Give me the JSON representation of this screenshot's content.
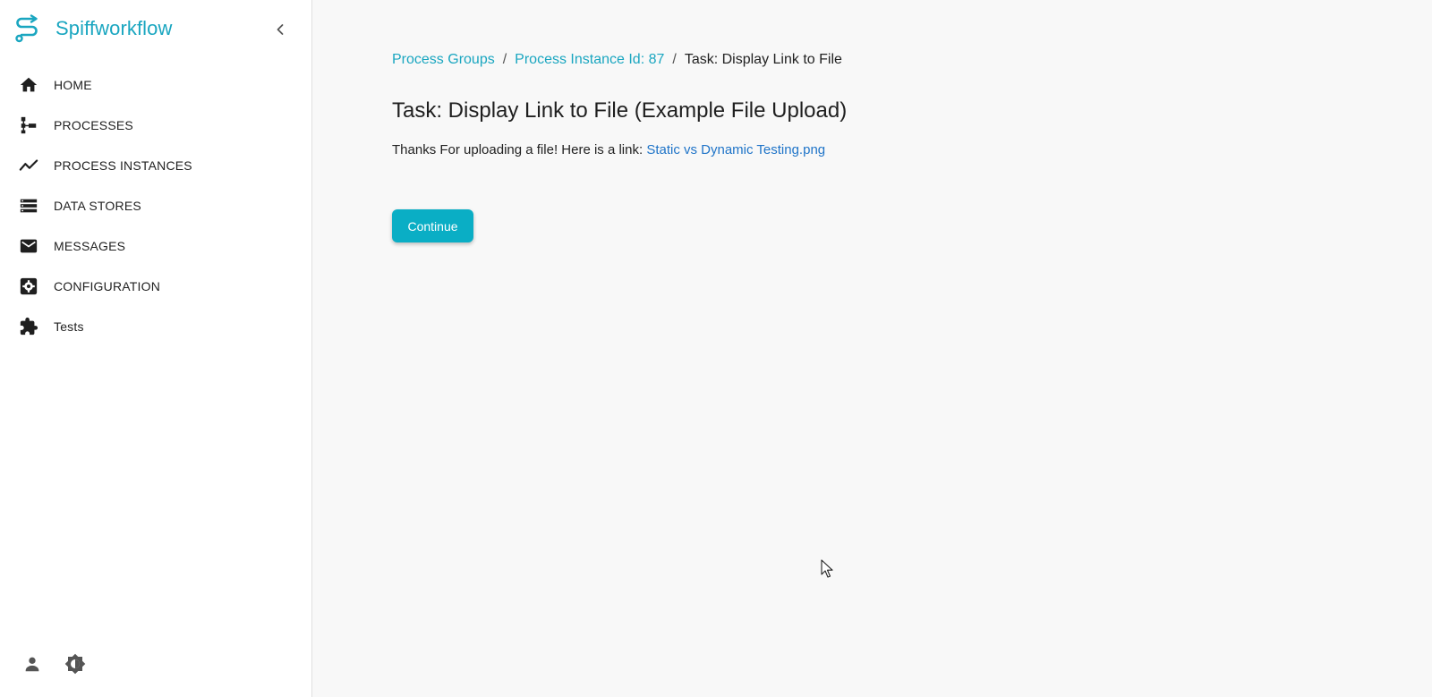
{
  "app": {
    "brand_name": "Spiffworkflow",
    "accent_color": "#1aa6c0",
    "button_color": "#0aaec5"
  },
  "sidebar": {
    "collapse_icon": "chevron-left-icon",
    "items": [
      {
        "label": "HOME",
        "icon": "home-icon"
      },
      {
        "label": "PROCESSES",
        "icon": "process-tree-icon"
      },
      {
        "label": "PROCESS INSTANCES",
        "icon": "trend-line-icon"
      },
      {
        "label": "DATA STORES",
        "icon": "storage-icon"
      },
      {
        "label": "MESSAGES",
        "icon": "mail-icon"
      },
      {
        "label": "CONFIGURATION",
        "icon": "settings-icon"
      },
      {
        "label": "Tests",
        "icon": "extension-icon"
      }
    ],
    "footer": {
      "user_icon": "user-icon",
      "theme_icon": "brightness-icon"
    }
  },
  "main": {
    "breadcrumb": {
      "items": [
        "Process Groups",
        "Process Instance Id: 87"
      ],
      "separator": "/",
      "current": "Task: Display Link to File"
    },
    "title": "Task: Display Link to File (Example File Upload)",
    "message_text": "Thanks For uploading a file! Here is a link: ",
    "file_link_text": "Static vs Dynamic Testing.png",
    "continue_label": "Continue"
  }
}
